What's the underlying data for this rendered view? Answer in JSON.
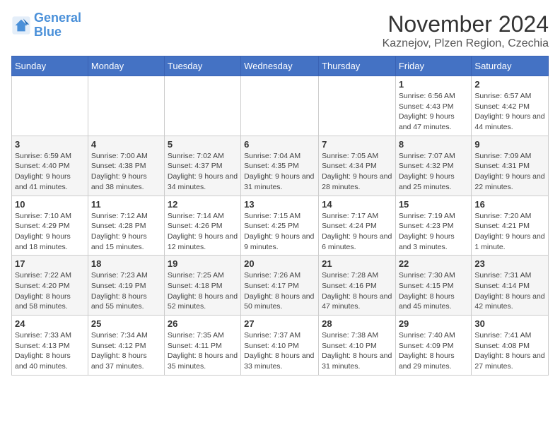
{
  "logo": {
    "line1": "General",
    "line2": "Blue"
  },
  "title": "November 2024",
  "subtitle": "Kaznejov, Plzen Region, Czechia",
  "days_of_week": [
    "Sunday",
    "Monday",
    "Tuesday",
    "Wednesday",
    "Thursday",
    "Friday",
    "Saturday"
  ],
  "weeks": [
    [
      {
        "day": "",
        "info": ""
      },
      {
        "day": "",
        "info": ""
      },
      {
        "day": "",
        "info": ""
      },
      {
        "day": "",
        "info": ""
      },
      {
        "day": "",
        "info": ""
      },
      {
        "day": "1",
        "info": "Sunrise: 6:56 AM\nSunset: 4:43 PM\nDaylight: 9 hours and 47 minutes."
      },
      {
        "day": "2",
        "info": "Sunrise: 6:57 AM\nSunset: 4:42 PM\nDaylight: 9 hours and 44 minutes."
      }
    ],
    [
      {
        "day": "3",
        "info": "Sunrise: 6:59 AM\nSunset: 4:40 PM\nDaylight: 9 hours and 41 minutes."
      },
      {
        "day": "4",
        "info": "Sunrise: 7:00 AM\nSunset: 4:38 PM\nDaylight: 9 hours and 38 minutes."
      },
      {
        "day": "5",
        "info": "Sunrise: 7:02 AM\nSunset: 4:37 PM\nDaylight: 9 hours and 34 minutes."
      },
      {
        "day": "6",
        "info": "Sunrise: 7:04 AM\nSunset: 4:35 PM\nDaylight: 9 hours and 31 minutes."
      },
      {
        "day": "7",
        "info": "Sunrise: 7:05 AM\nSunset: 4:34 PM\nDaylight: 9 hours and 28 minutes."
      },
      {
        "day": "8",
        "info": "Sunrise: 7:07 AM\nSunset: 4:32 PM\nDaylight: 9 hours and 25 minutes."
      },
      {
        "day": "9",
        "info": "Sunrise: 7:09 AM\nSunset: 4:31 PM\nDaylight: 9 hours and 22 minutes."
      }
    ],
    [
      {
        "day": "10",
        "info": "Sunrise: 7:10 AM\nSunset: 4:29 PM\nDaylight: 9 hours and 18 minutes."
      },
      {
        "day": "11",
        "info": "Sunrise: 7:12 AM\nSunset: 4:28 PM\nDaylight: 9 hours and 15 minutes."
      },
      {
        "day": "12",
        "info": "Sunrise: 7:14 AM\nSunset: 4:26 PM\nDaylight: 9 hours and 12 minutes."
      },
      {
        "day": "13",
        "info": "Sunrise: 7:15 AM\nSunset: 4:25 PM\nDaylight: 9 hours and 9 minutes."
      },
      {
        "day": "14",
        "info": "Sunrise: 7:17 AM\nSunset: 4:24 PM\nDaylight: 9 hours and 6 minutes."
      },
      {
        "day": "15",
        "info": "Sunrise: 7:19 AM\nSunset: 4:23 PM\nDaylight: 9 hours and 3 minutes."
      },
      {
        "day": "16",
        "info": "Sunrise: 7:20 AM\nSunset: 4:21 PM\nDaylight: 9 hours and 1 minute."
      }
    ],
    [
      {
        "day": "17",
        "info": "Sunrise: 7:22 AM\nSunset: 4:20 PM\nDaylight: 8 hours and 58 minutes."
      },
      {
        "day": "18",
        "info": "Sunrise: 7:23 AM\nSunset: 4:19 PM\nDaylight: 8 hours and 55 minutes."
      },
      {
        "day": "19",
        "info": "Sunrise: 7:25 AM\nSunset: 4:18 PM\nDaylight: 8 hours and 52 minutes."
      },
      {
        "day": "20",
        "info": "Sunrise: 7:26 AM\nSunset: 4:17 PM\nDaylight: 8 hours and 50 minutes."
      },
      {
        "day": "21",
        "info": "Sunrise: 7:28 AM\nSunset: 4:16 PM\nDaylight: 8 hours and 47 minutes."
      },
      {
        "day": "22",
        "info": "Sunrise: 7:30 AM\nSunset: 4:15 PM\nDaylight: 8 hours and 45 minutes."
      },
      {
        "day": "23",
        "info": "Sunrise: 7:31 AM\nSunset: 4:14 PM\nDaylight: 8 hours and 42 minutes."
      }
    ],
    [
      {
        "day": "24",
        "info": "Sunrise: 7:33 AM\nSunset: 4:13 PM\nDaylight: 8 hours and 40 minutes."
      },
      {
        "day": "25",
        "info": "Sunrise: 7:34 AM\nSunset: 4:12 PM\nDaylight: 8 hours and 37 minutes."
      },
      {
        "day": "26",
        "info": "Sunrise: 7:35 AM\nSunset: 4:11 PM\nDaylight: 8 hours and 35 minutes."
      },
      {
        "day": "27",
        "info": "Sunrise: 7:37 AM\nSunset: 4:10 PM\nDaylight: 8 hours and 33 minutes."
      },
      {
        "day": "28",
        "info": "Sunrise: 7:38 AM\nSunset: 4:10 PM\nDaylight: 8 hours and 31 minutes."
      },
      {
        "day": "29",
        "info": "Sunrise: 7:40 AM\nSunset: 4:09 PM\nDaylight: 8 hours and 29 minutes."
      },
      {
        "day": "30",
        "info": "Sunrise: 7:41 AM\nSunset: 4:08 PM\nDaylight: 8 hours and 27 minutes."
      }
    ]
  ]
}
